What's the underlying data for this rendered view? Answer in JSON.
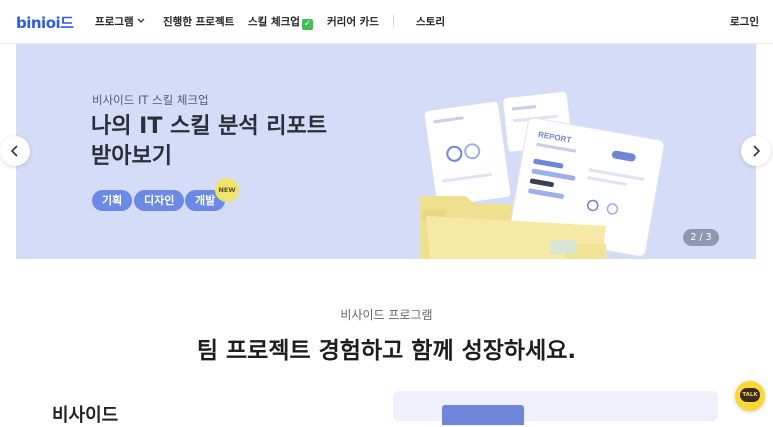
{
  "header": {
    "logo": "binioi드",
    "nav": [
      {
        "label": "프로그램"
      },
      {
        "label": "진행한 프로젝트"
      },
      {
        "label": "스킬 체크업"
      },
      {
        "label": "커리어 카드"
      },
      {
        "label": "스토리"
      }
    ],
    "login_label": "로그인"
  },
  "banner": {
    "eyebrow": "비사이드 IT 스킬 체크업",
    "title_line1": "나의 IT 스킬 분석 리포트",
    "title_line2": "받아보기",
    "chips": [
      "기획",
      "디자인",
      "개발"
    ],
    "new_badge": "NEW",
    "counter": "2 / 3",
    "report_label": "REPORT",
    "background_color": "#d4dcf7"
  },
  "section": {
    "eyebrow": "비사이드 프로그램",
    "title": "팀 프로젝트 경험하고 함께 성장하세요.",
    "lower_text": "비사이드"
  },
  "talk": {
    "label": "TALK"
  },
  "icons": {
    "prev": "chevron-left-icon",
    "next": "chevron-right-icon",
    "dropdown": "chevron-down-icon",
    "check": "check-icon"
  },
  "colors": {
    "brand": "#2f5be8",
    "chip": "#6b8ae8",
    "folder": "#f2e49a",
    "talk": "#f7d834"
  }
}
